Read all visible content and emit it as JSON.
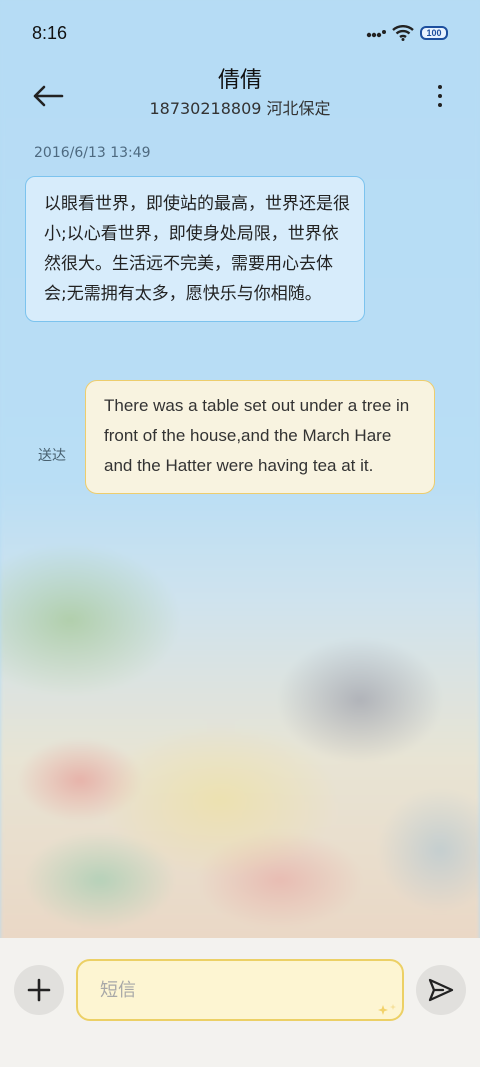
{
  "status_bar": {
    "time": "8:16",
    "battery": "100"
  },
  "header": {
    "contact_name": "倩倩",
    "contact_subtitle": "18730218809 河北保定"
  },
  "conversation": {
    "timestamp": "2016/6/13 13:49",
    "incoming_message": "以眼看世界，即使站的最高，世界还是很小;以心看世界，即使身处局限，世界依然很大。生活远不完美，需要用心去体会;无需拥有太多，愿快乐与你相随。",
    "outgoing_message": "There was a table set out under a tree in front of the house,and the March Hare and the Hatter were having tea at it.",
    "delivered_label": "送达"
  },
  "composer": {
    "placeholder": "短信"
  },
  "colors": {
    "incoming_bubble": "#d7ecfb",
    "outgoing_bubble": "#f8f3e0",
    "input_border": "#ecd065"
  }
}
